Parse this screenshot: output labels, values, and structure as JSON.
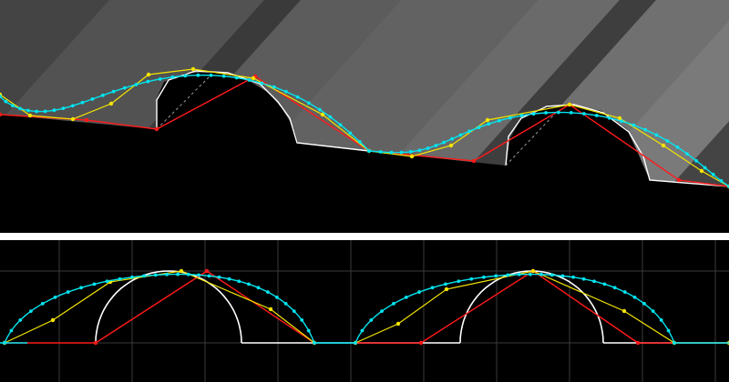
{
  "colors": {
    "background": "#000000",
    "divider": "#ffffff",
    "surface_band_dark": "#3c3c3c",
    "surface_band_light": "#8a8a8a",
    "tooth_outline": "#ffffff",
    "dense_curve": "#00e5f0",
    "control_curve": "#f4e500",
    "control_point": "#f4e500",
    "red_polygon": "#ff1a1a",
    "red_point": "#ff1a1a",
    "grid": "#3a3a3a",
    "guide_dashed": "#9a9a9a"
  },
  "icons": {
    "top_view": "perspective-profile-view",
    "bottom_view": "flattened-profile-view"
  },
  "grid": {
    "vertical_lines": 10,
    "horizontal_lines": 2
  }
}
